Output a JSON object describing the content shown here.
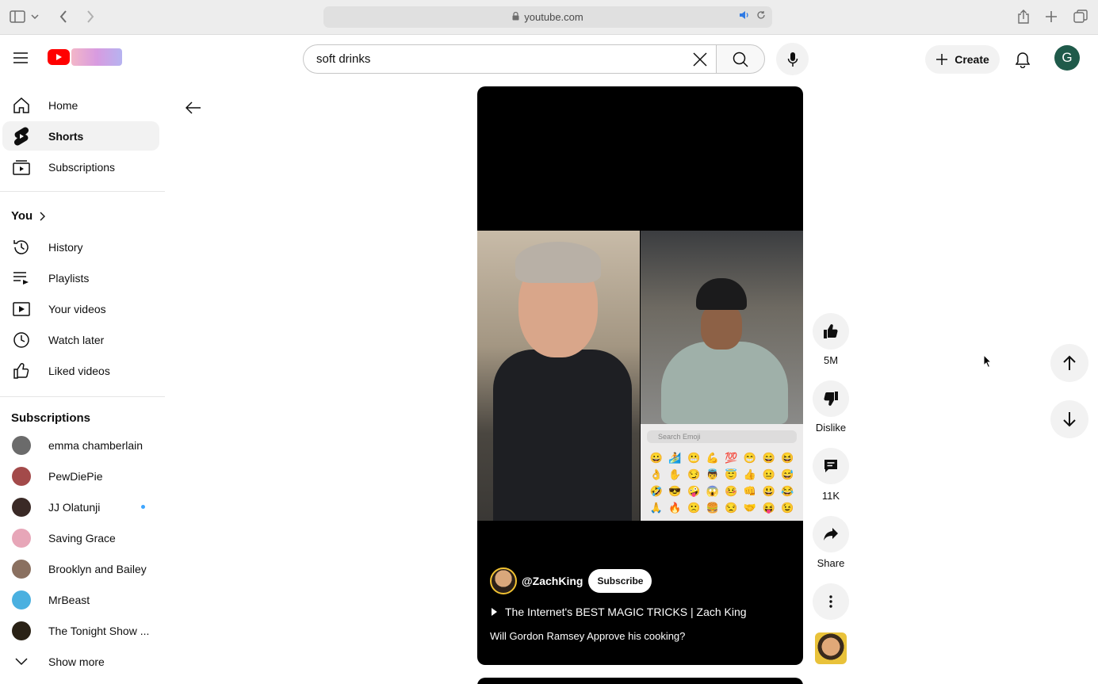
{
  "browser": {
    "url": "youtube.com",
    "icons": [
      "sidebar-toggle-icon",
      "chevron-down-icon",
      "back-icon",
      "forward-icon",
      "lock-icon",
      "speaker-icon",
      "reload-icon",
      "share-icon",
      "new-tab-icon",
      "tabs-overview-icon"
    ]
  },
  "header": {
    "search_value": "soft drinks",
    "create_label": "Create",
    "avatar_letter": "G"
  },
  "sidebar": {
    "main": [
      {
        "label": "Home",
        "icon": "home-icon",
        "active": false
      },
      {
        "label": "Shorts",
        "icon": "shorts-icon",
        "active": true
      },
      {
        "label": "Subscriptions",
        "icon": "subscriptions-icon",
        "active": false
      }
    ],
    "you_title": "You",
    "you_items": [
      {
        "label": "History",
        "icon": "history-icon"
      },
      {
        "label": "Playlists",
        "icon": "playlists-icon"
      },
      {
        "label": "Your videos",
        "icon": "your-videos-icon"
      },
      {
        "label": "Watch later",
        "icon": "watch-later-icon"
      },
      {
        "label": "Liked videos",
        "icon": "liked-videos-icon"
      }
    ],
    "subscriptions_title": "Subscriptions",
    "subscriptions": [
      {
        "label": "emma chamberlain",
        "color": "#6b6b6b",
        "live": false
      },
      {
        "label": "PewDiePie",
        "color": "#a34a4a",
        "live": false
      },
      {
        "label": "JJ Olatunji",
        "color": "#3a2a26",
        "live": true
      },
      {
        "label": "Saving Grace",
        "color": "#e7a6b8",
        "live": false
      },
      {
        "label": "Brooklyn and Bailey",
        "color": "#8a7060",
        "live": false
      },
      {
        "label": "MrBeast",
        "color": "#4ab0e0",
        "live": false
      },
      {
        "label": "The Tonight Show ...",
        "color": "#2a2216",
        "live": false
      }
    ],
    "show_more": "Show more"
  },
  "short": {
    "channel": "@ZachKing",
    "subscribe_label": "Subscribe",
    "playlist": "The Internet's BEST MAGIC TRICKS | Zach King",
    "title": "Will Gordon Ramsey Approve his cooking?",
    "emoji_search_placeholder": "Search Emoji",
    "emojis": [
      "😀",
      "🏄",
      "😬",
      "💪",
      "💯",
      "😁",
      "😄",
      "😆",
      "👌",
      "✋",
      "😏",
      "👼",
      "😇",
      "👍",
      "😐",
      "😅",
      "🤣",
      "😎",
      "🤪",
      "😱",
      "🤒",
      "👊",
      "😃",
      "😂",
      "🙏",
      "🔥",
      "🙁",
      "🍔",
      "😒",
      "🤝",
      "😝",
      "😉"
    ]
  },
  "actions": {
    "likes": "5M",
    "dislike_label": "Dislike",
    "comments": "11K",
    "share_label": "Share"
  },
  "colors": {
    "youtube_red": "#ff0000",
    "avatar_bg": "#1f5a4a",
    "active_bg": "#f2f2f2"
  }
}
